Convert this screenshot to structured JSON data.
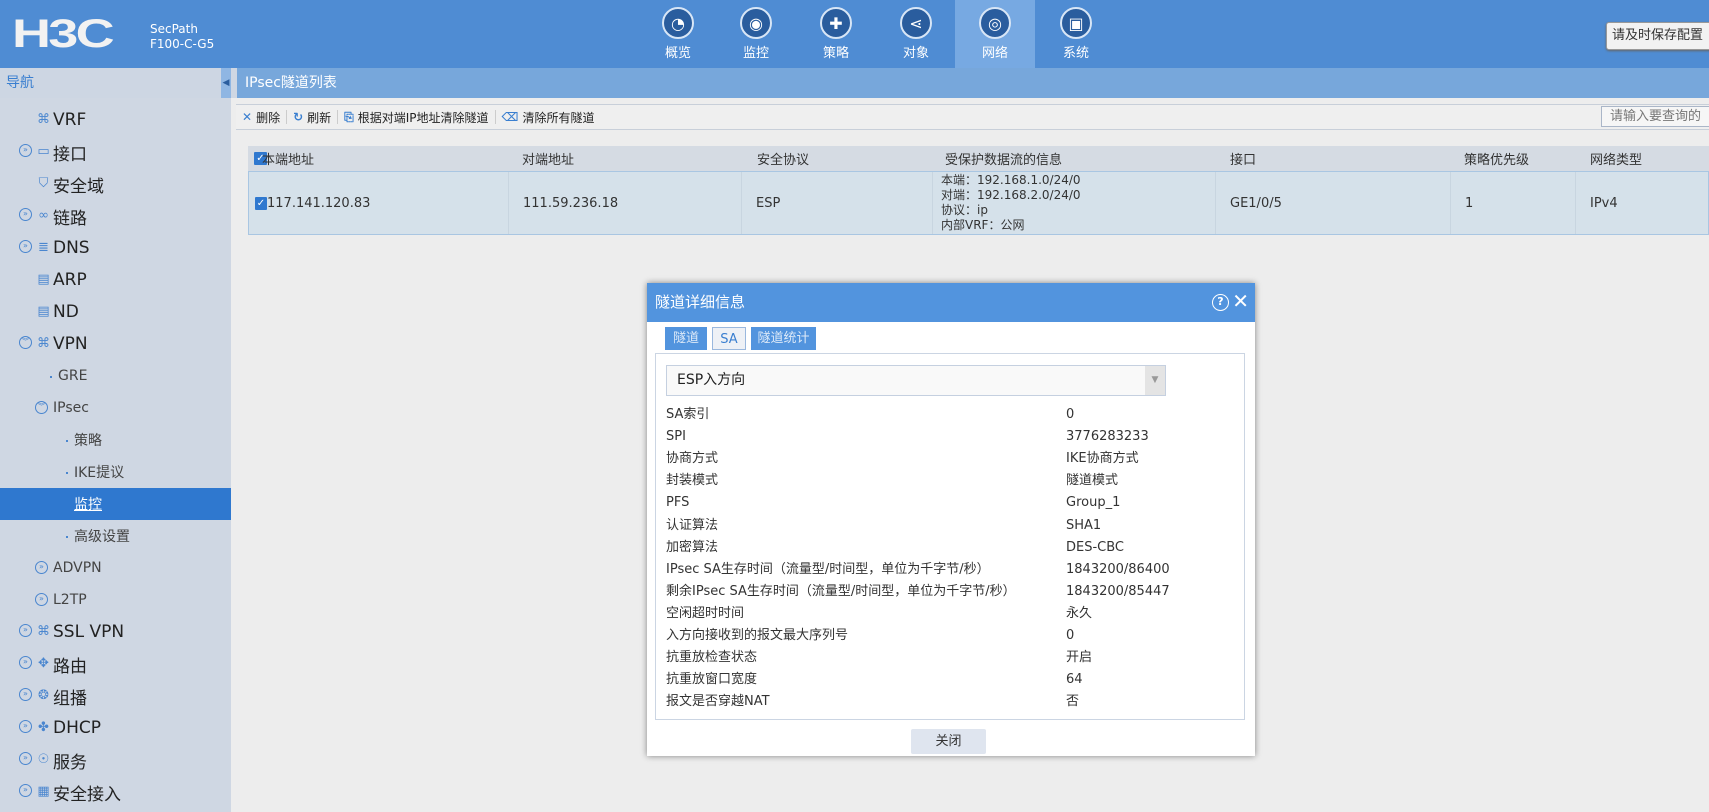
{
  "header": {
    "logo": "H3C",
    "product_line": "SecPath",
    "model": "F100-C-G5",
    "save_config": "请及时保存配置",
    "nav": [
      {
        "label": "概览",
        "icon": "gauge-icon",
        "glyph": "◔"
      },
      {
        "label": "监控",
        "icon": "monitor-camera-icon",
        "glyph": "◉"
      },
      {
        "label": "策略",
        "icon": "shield-plus-icon",
        "glyph": "✚"
      },
      {
        "label": "对象",
        "icon": "share-nodes-icon",
        "glyph": "⋖"
      },
      {
        "label": "网络",
        "icon": "globe-icon",
        "glyph": "◎",
        "active": true
      },
      {
        "label": "系统",
        "icon": "system-screen-icon",
        "glyph": "▣"
      }
    ]
  },
  "sidebar": {
    "title": "导航",
    "items": [
      {
        "label": "VRF",
        "level": 1,
        "icon": "vrf-icon",
        "glyph": "⌘",
        "expander": null
      },
      {
        "label": "接口",
        "level": 1,
        "icon": "interface-port-icon",
        "glyph": "▭",
        "expander": "expand"
      },
      {
        "label": "安全域",
        "level": 1,
        "icon": "security-zone-shield-icon",
        "glyph": "⛉",
        "expander": null
      },
      {
        "label": "链路",
        "level": 1,
        "icon": "link-chain-icon",
        "glyph": "∞",
        "expander": "expand"
      },
      {
        "label": "DNS",
        "level": 1,
        "icon": "dns-database-icon",
        "glyph": "≣",
        "expander": "expand"
      },
      {
        "label": "ARP",
        "level": 1,
        "icon": "arp-device-icon",
        "glyph": "▤",
        "expander": null
      },
      {
        "label": "ND",
        "level": 1,
        "icon": "nd-device-icon",
        "glyph": "▤",
        "expander": null
      },
      {
        "label": "VPN",
        "level": 1,
        "icon": "vpn-icon",
        "glyph": "⌘",
        "expander": "collapse"
      },
      {
        "label": "GRE",
        "level": 2,
        "expander": null
      },
      {
        "label": "IPsec",
        "level": 2,
        "expander": "collapse"
      },
      {
        "label": "策略",
        "level": 3
      },
      {
        "label": "IKE提议",
        "level": 3
      },
      {
        "label": "监控",
        "level": 3,
        "active": true
      },
      {
        "label": "高级设置",
        "level": 3
      },
      {
        "label": "ADVPN",
        "level": 2,
        "expander": "expand"
      },
      {
        "label": "L2TP",
        "level": 2,
        "expander": "expand"
      },
      {
        "label": "SSL VPN",
        "level": 1,
        "icon": "ssl-vpn-icon",
        "glyph": "⌘",
        "expander": "expand"
      },
      {
        "label": "路由",
        "level": 1,
        "icon": "routing-icon",
        "glyph": "✥",
        "expander": "expand"
      },
      {
        "label": "组播",
        "level": 1,
        "icon": "multicast-icon",
        "glyph": "❂",
        "expander": "expand"
      },
      {
        "label": "DHCP",
        "level": 1,
        "icon": "dhcp-fan-icon",
        "glyph": "✤",
        "expander": "expand"
      },
      {
        "label": "服务",
        "level": 1,
        "icon": "service-hand-icon",
        "glyph": "☉",
        "expander": "expand"
      },
      {
        "label": "安全接入",
        "level": 1,
        "icon": "security-access-doc-icon",
        "glyph": "▦",
        "expander": "expand"
      }
    ]
  },
  "main": {
    "title": "IPsec隧道列表",
    "toolbar": {
      "delete": "删除",
      "refresh": "刷新",
      "clear_by_peer": "根据对端IP地址清除隧道",
      "clear_all": "清除所有隧道",
      "search_placeholder": "请输入要查询的"
    },
    "table": {
      "headers": [
        "本端地址",
        "对端地址",
        "安全协议",
        "受保护数据流的信息",
        "接口",
        "策略优先级",
        "网络类型"
      ],
      "rows": [
        {
          "checked": true,
          "local": "117.141.120.83",
          "peer": "111.59.236.18",
          "protocol": "ESP",
          "flow": [
            "本端：192.168.1.0/24/0",
            "对端：192.168.2.0/24/0",
            "协议：ip",
            "内部VRF：公网"
          ],
          "interface": "GE1/0/5",
          "priority": "1",
          "net_type": "IPv4"
        }
      ]
    }
  },
  "dialog": {
    "title": "隧道详细信息",
    "tabs": [
      "隧道",
      "SA",
      "隧道统计"
    ],
    "active_tab": "SA",
    "direction": "ESP入方向",
    "close": "关闭",
    "fields": [
      [
        "SA索引",
        "0"
      ],
      [
        "SPI",
        "3776283233"
      ],
      [
        "协商方式",
        "IKE协商方式"
      ],
      [
        "封装模式",
        "隧道模式"
      ],
      [
        "PFS",
        "Group_1"
      ],
      [
        "认证算法",
        "SHA1"
      ],
      [
        "加密算法",
        "DES-CBC"
      ],
      [
        "IPsec SA生存时间（流量型/时间型，单位为千字节/秒）",
        "1843200/86400"
      ],
      [
        "剩余IPsec SA生存时间（流量型/时间型，单位为千字节/秒）",
        "1843200/85447"
      ],
      [
        "空闲超时时间",
        "永久"
      ],
      [
        "入方向接收到的报文最大序列号",
        "0"
      ],
      [
        "抗重放检查状态",
        "开启"
      ],
      [
        "抗重放窗口宽度",
        "64"
      ],
      [
        "报文是否穿越NAT",
        "否"
      ]
    ]
  },
  "colors": {
    "header": "#4f8cd3",
    "active": "#2f78cf",
    "dialog_title": "#5294de"
  }
}
